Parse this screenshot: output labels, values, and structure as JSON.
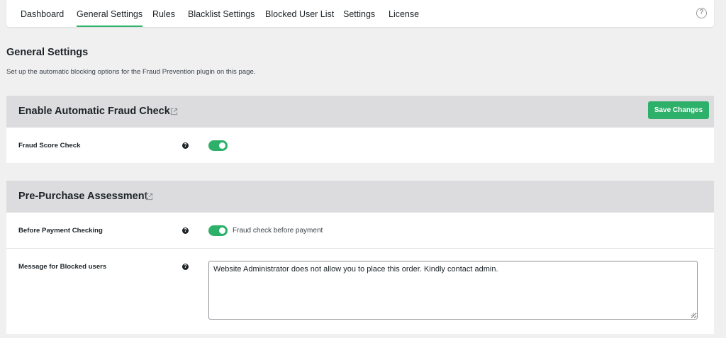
{
  "nav": {
    "items": [
      {
        "label": "Dashboard"
      },
      {
        "label": "General Settings"
      },
      {
        "label": "Rules"
      },
      {
        "label": "Blacklist Settings"
      },
      {
        "label": "Blocked User List"
      },
      {
        "label": "Settings"
      },
      {
        "label": "License"
      }
    ],
    "active_index": 1,
    "help_glyph": "?"
  },
  "page": {
    "title": "General Settings",
    "description": "Set up the automatic blocking options for the Fraud Prevention plugin on this page."
  },
  "sections": [
    {
      "title": "Enable Automatic Fraud Check",
      "save_label": "Save Changes",
      "rows": [
        {
          "label": "Fraud Score Check",
          "toggle_on": true
        }
      ]
    },
    {
      "title": "Pre-Purchase Assessment",
      "rows": [
        {
          "label": "Before Payment Checking",
          "toggle_on": true,
          "toggle_text": "Fraud check before payment"
        },
        {
          "label": "Message for Blocked users",
          "message": "Website Administrator does not allow you to place this order. Kindly contact admin."
        }
      ]
    }
  ],
  "colors": {
    "accent": "#2db06a",
    "background": "#f0f0f1",
    "section_header": "#dcdcde"
  },
  "icons": {
    "help": "question-circle-icon",
    "external": "external-link-icon",
    "tooltip": "question-filled-icon"
  }
}
